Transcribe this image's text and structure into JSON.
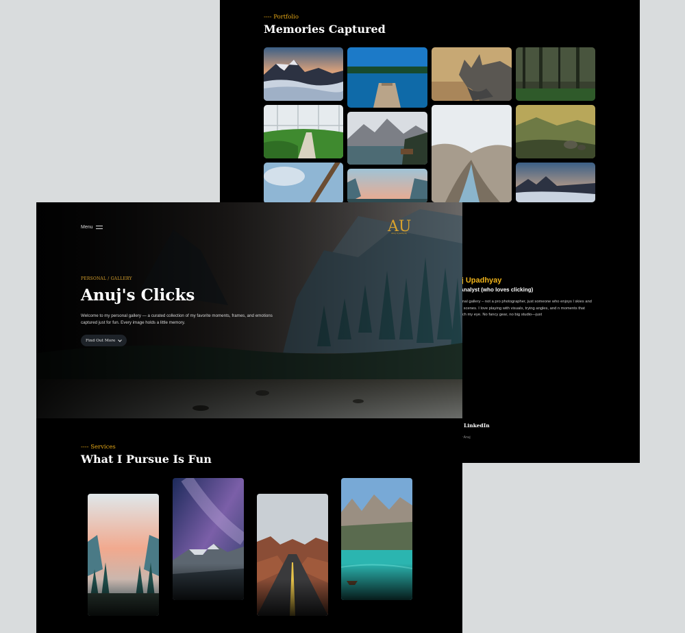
{
  "portfolio": {
    "eyebrow": "---- Portfolio",
    "title": "Memories Captured",
    "gallery": [
      {
        "subject": "snowy mountain ridge above a sea of clouds at sunset"
      },
      {
        "subject": "wooden pier on a still blue lake"
      },
      {
        "subject": "rhinoceros portrait in dry grass"
      },
      {
        "subject": "misty green forest"
      },
      {
        "subject": "inside a greenhouse with rows of plants"
      },
      {
        "subject": "mountain lake with a small wooden cabin"
      },
      {
        "subject": "misty canyon with a winding river"
      },
      {
        "subject": "valley with golden light and boulders"
      },
      {
        "subject": "sky with tree trunk viewed from below"
      },
      {
        "subject": "mountain valley at dusk"
      },
      {
        "subject": "snowy mountain ridge above clouds at sunset"
      }
    ]
  },
  "about": {
    "name": "uj Upadhyay",
    "role": "/ Analyst (who loves clicking)",
    "bio": "rsonal gallery – not a pro photographer, just someone who enjoys l skies and fun scenes. I love playing with visuals, trying angles, and n moments that catch my eye. No fancy gear, no big studio—just",
    "link_label": "LinkedIn",
    "credit": "y Anuj"
  },
  "hero": {
    "menu_label": "Menu",
    "logo_letters": "AU",
    "logo_tagline": "Anuj Upadhyay",
    "kicker": "PERSONAL / GALLERY",
    "title": "Anuj's Clicks",
    "description": "Welcome to my personal gallery — a curated collection of my favorite moments, frames, and emotions captured just for fun. Every image holds a little memory.",
    "cta_label": "Find Out More",
    "cta_icon": "chevron-down-icon"
  },
  "services": {
    "eyebrow": "---- Services",
    "title": "What I Pursue Is Fun",
    "cards": [
      {
        "subject": "mountain valley at sunset with pine trees"
      },
      {
        "subject": "milky way over snowy mountains"
      },
      {
        "subject": "desert road through red canyon"
      },
      {
        "subject": "turquoise alpine lake with a boat"
      }
    ]
  },
  "colors": {
    "accent": "#e6a817",
    "background": "#000000",
    "page": "#d9dcdd"
  }
}
